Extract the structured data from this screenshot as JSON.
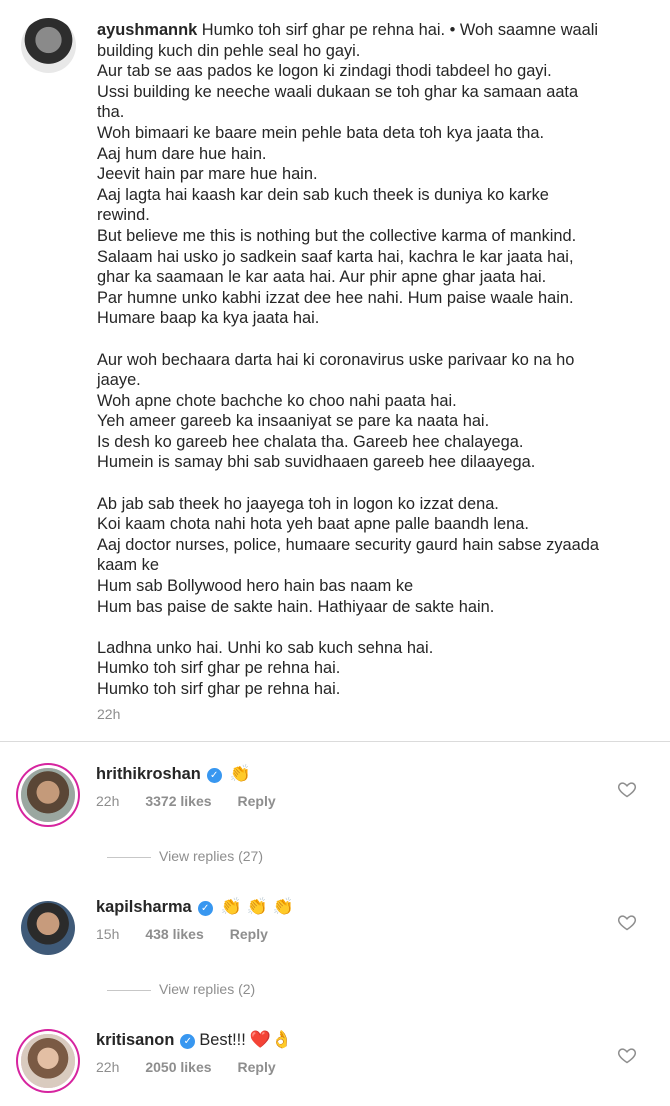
{
  "caption": {
    "username": "ayushmannk",
    "lines": [
      "Humko toh sirf ghar pe rehna hai. • Woh saamne waali",
      "building kuch din pehle seal ho gayi.",
      "Aur tab se aas pados ke logon ki zindagi thodi tabdeel ho gayi.",
      "Ussi building ke neeche waali dukaan se toh ghar ka samaan aata",
      "tha.",
      "Woh bimaari ke baare mein pehle bata deta toh kya jaata tha.",
      "Aaj hum dare hue hain.",
      "Jeevit hain par mare hue hain.",
      "Aaj lagta hai kaash kar dein sab kuch theek is duniya ko karke",
      "rewind.",
      "But believe me this is nothing but the collective karma of mankind.",
      "Salaam hai usko jo sadkein saaf karta hai, kachra le kar jaata hai,",
      "ghar ka saamaan le kar aata hai. Aur phir apne ghar jaata hai.",
      "Par humne unko kabhi izzat dee hee nahi. Hum paise waale hain.",
      "Humare baap ka kya jaata hai.",
      "",
      "Aur woh bechaara darta hai ki coronavirus uske parivaar ko na ho",
      "jaaye.",
      "Woh apne chote bachche ko choo nahi paata hai.",
      "Yeh ameer gareeb ka insaaniyat se pare ka naata hai.",
      "Is desh ko gareeb hee chalata tha. Gareeb hee chalayega.",
      "Humein is samay bhi sab suvidhaaen gareeb hee dilaayega.",
      "",
      "Ab jab sab theek ho jaayega toh in logon ko izzat dena.",
      "Koi kaam chota nahi hota yeh baat apne palle baandh lena.",
      "Aaj doctor nurses, police, humaare security gaurd hain sabse zyaada",
      "kaam ke",
      "Hum sab Bollywood hero hain bas naam ke",
      "Hum bas paise de sakte hain. Hathiyaar de sakte hain.",
      "",
      "Ladhna unko hai. Unhi ko sab kuch sehna hai.",
      "Humko toh sirf ghar pe rehna hai.",
      "Humko toh sirf ghar pe rehna hai."
    ],
    "time": "22h"
  },
  "comments": [
    {
      "username": "hrithikroshan",
      "text": "",
      "emojis": "👏",
      "time": "22h",
      "likes": "3372 likes",
      "reply": "Reply",
      "view_replies": "View replies (27)"
    },
    {
      "username": "kapilsharma",
      "text": "",
      "emojis": "👏 👏 👏",
      "time": "15h",
      "likes": "438 likes",
      "reply": "Reply",
      "view_replies": "View replies (2)"
    },
    {
      "username": "kritisanon",
      "text": "Best!!!",
      "emojis": "❤️👌",
      "time": "22h",
      "likes": "2050 likes",
      "reply": "Reply",
      "view_replies": ""
    }
  ],
  "colors": {
    "text": "#262626",
    "secondary": "#8e8e8e",
    "verified": "#3897f0",
    "story_ring": "#d6249f"
  }
}
